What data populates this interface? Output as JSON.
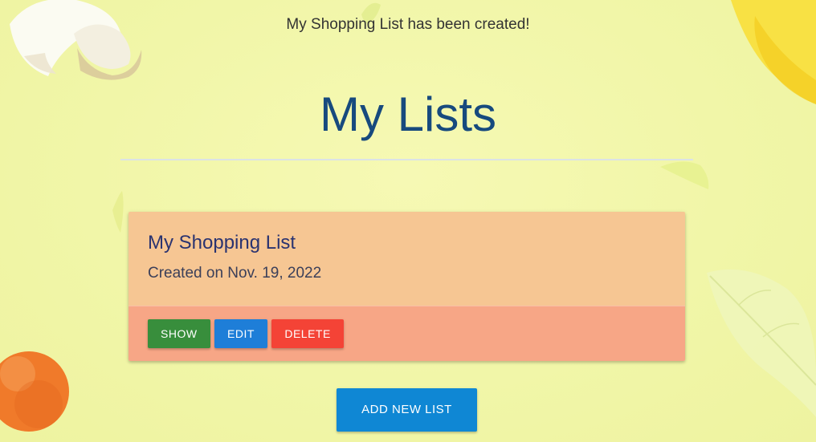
{
  "flash": {
    "message": "My Shopping List has been created!"
  },
  "page": {
    "title": "My Lists"
  },
  "lists": [
    {
      "name": "My Shopping List",
      "created": "Created on Nov. 19, 2022",
      "actions": {
        "show": "SHOW",
        "edit": "EDIT",
        "delete": "DELETE"
      }
    }
  ],
  "add_button": {
    "label": "ADD NEW LIST"
  },
  "colors": {
    "title": "#174a7e",
    "card_top": "#f6c693",
    "card_bottom": "#f7a686",
    "show_button": "#388e3c",
    "edit_button": "#1e7ed8",
    "delete_button": "#f44336",
    "add_button": "#0f87d4"
  }
}
